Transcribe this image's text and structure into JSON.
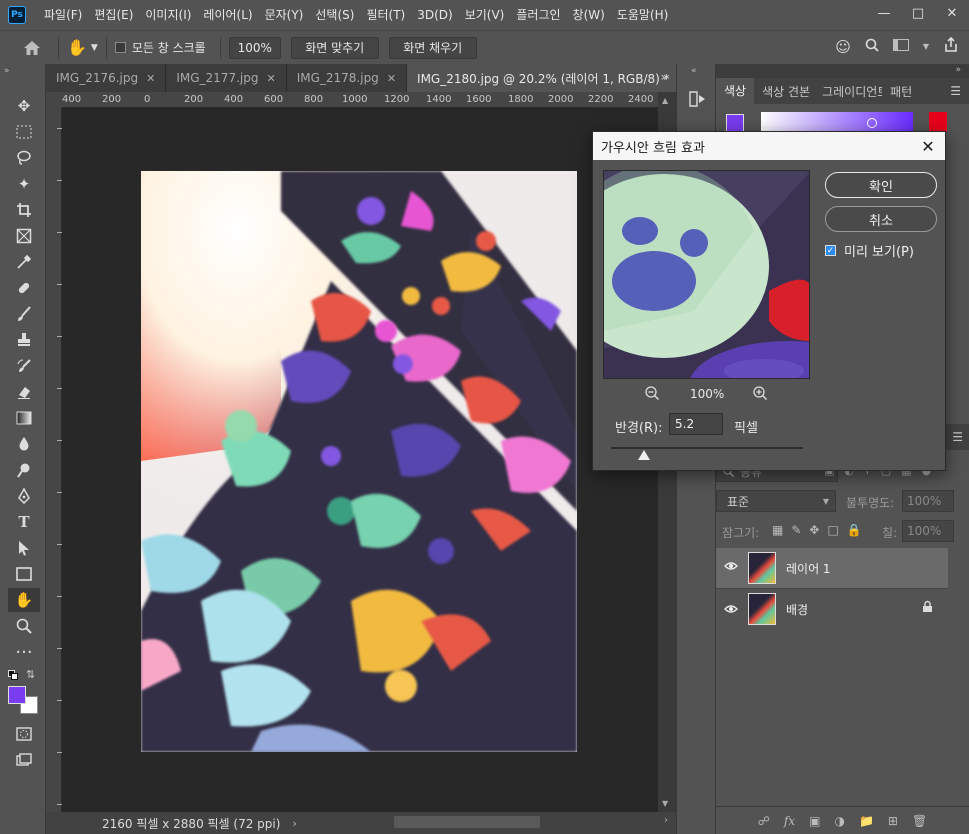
{
  "app": {
    "logo": "Ps"
  },
  "menu": [
    "파일(F)",
    "편집(E)",
    "이미지(I)",
    "레이어(L)",
    "문자(Y)",
    "선택(S)",
    "필터(T)",
    "3D(D)",
    "보기(V)",
    "플러그인",
    "창(W)",
    "도움말(H)"
  ],
  "options": {
    "scroll_all_label": "모든 창 스크롤",
    "zoom_value": "100%",
    "fit_screen_label": "화면 맞추기",
    "fill_screen_label": "화면 채우기"
  },
  "tabs": [
    {
      "label": "IMG_2176.jpg",
      "active": false
    },
    {
      "label": "IMG_2177.jpg",
      "active": false
    },
    {
      "label": "IMG_2178.jpg",
      "active": false
    },
    {
      "label": "IMG_2180.jpg @ 20.2% (레이어 1, RGB/8) *",
      "active": true
    }
  ],
  "ruler_labels": [
    "400",
    "200",
    "0",
    "200",
    "400",
    "600",
    "800",
    "1000",
    "1200",
    "1400",
    "1600",
    "1800",
    "2000",
    "2200",
    "2400"
  ],
  "status": {
    "doc_size": "2160 픽셀 x 2880 픽셀 (72 ppi)"
  },
  "color_panel": {
    "tabs": [
      "색상",
      "색상 견본",
      "그레이디언트",
      "패턴"
    ],
    "foreground": "#7a3cf0",
    "accent_red": "#e8001c"
  },
  "layers_panel": {
    "search_placeholder": "종류",
    "blend_mode": "표준",
    "opacity_label": "불투명도:",
    "opacity_value": "100%",
    "lock_label": "잠그기:",
    "fill_label": "칠:",
    "fill_value": "100%",
    "layers": [
      {
        "name": "레이어 1",
        "selected": true,
        "locked": false
      },
      {
        "name": "배경",
        "selected": false,
        "locked": true
      }
    ]
  },
  "dialog": {
    "title": "가우시안 흐림 효과",
    "ok_label": "확인",
    "cancel_label": "취소",
    "preview_label": "미리 보기(P)",
    "preview_checked": true,
    "zoom_value": "100%",
    "radius_label": "반경(R):",
    "radius_value": "5.2",
    "radius_unit": "픽셀",
    "radius_slider": 0.17
  }
}
